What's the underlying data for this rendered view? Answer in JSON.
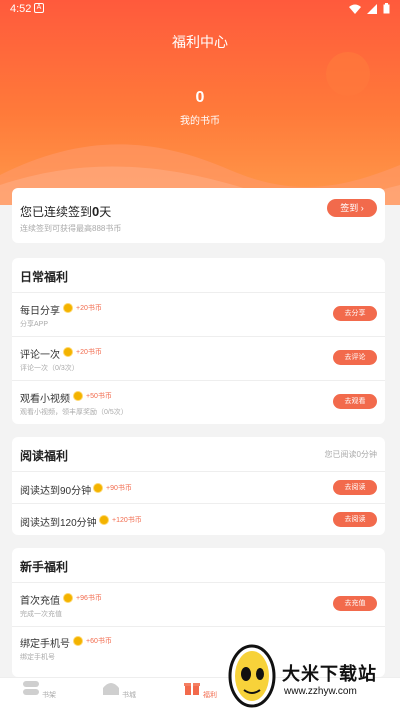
{
  "status_bar": {
    "time": "4:52",
    "badge": "A"
  },
  "header": {
    "title": "福利中心",
    "coin_value": "0",
    "coin_label": "我的书币"
  },
  "signin": {
    "title_prefix": "您已连续签到",
    "days": "0",
    "title_suffix": "天",
    "subtitle": "连续签到可获得最高888书币",
    "button": "签到 ›"
  },
  "daily": {
    "title": "日常福利",
    "tasks": [
      {
        "name": "每日分享",
        "reward": "+20书币",
        "desc": "分享APP",
        "button": "去分享"
      },
      {
        "name": "评论一次",
        "reward": "+20书币",
        "desc": "评论一次（0/3次）",
        "button": "去评论"
      },
      {
        "name": "观看小视频",
        "reward": "+50书币",
        "desc": "观看小视频，领丰厚奖励（0/5次）",
        "button": "去观看"
      }
    ]
  },
  "reading": {
    "title": "阅读福利",
    "side": "您已阅读0分钟",
    "tasks": [
      {
        "name": "阅读达到90分钟",
        "reward": "+90书币",
        "button": "去阅读"
      },
      {
        "name": "阅读达到120分钟",
        "reward": "+120书币",
        "button": "去阅读"
      }
    ]
  },
  "newbie": {
    "title": "新手福利",
    "tasks": [
      {
        "name": "首次充值",
        "reward": "+96书币",
        "desc": "完成一次充值",
        "button": "去充值"
      },
      {
        "name": "绑定手机号",
        "reward": "+60书币",
        "desc": "绑定手机号"
      }
    ]
  },
  "nav": {
    "bookshelf": "书架",
    "store": "书城",
    "welfare": "福利"
  },
  "watermark": {
    "text": "大米下载站",
    "url": "www.zzhyw.com"
  },
  "colors": {
    "accent": "#f26a4c",
    "header_start": "#ff5a3c",
    "header_end": "#ff9a4a"
  }
}
